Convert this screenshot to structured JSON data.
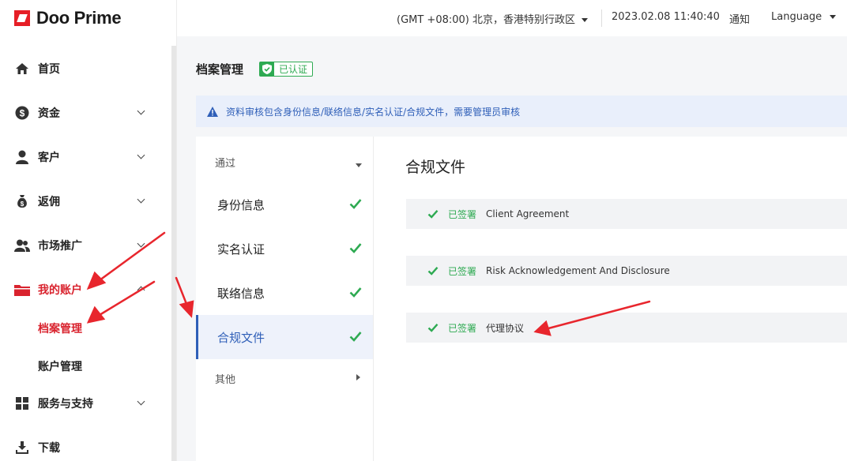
{
  "brand": {
    "name": "Doo Prime"
  },
  "topbar": {
    "timezone": "(GMT +08:00) 北京，香港特别行政区",
    "datetime": "2023.02.08 11:40:40",
    "notifications": "通知",
    "language": "Language"
  },
  "sidebar": {
    "items": [
      {
        "label": "首页",
        "icon": "home-icon"
      },
      {
        "label": "资金",
        "icon": "dollar-icon"
      },
      {
        "label": "客户",
        "icon": "user-icon"
      },
      {
        "label": "返佣",
        "icon": "money-bag-icon"
      },
      {
        "label": "市场推广",
        "icon": "users-icon"
      },
      {
        "label": "我的账户",
        "icon": "folder-icon"
      },
      {
        "label": "服务与支持",
        "icon": "grid-icon"
      },
      {
        "label": "下载",
        "icon": "download-icon"
      }
    ],
    "subitems": [
      {
        "label": "档案管理"
      },
      {
        "label": "账户管理"
      }
    ]
  },
  "page": {
    "title": "档案管理",
    "badge": "已认证",
    "notice": "资料审核包含身份信息/联络信息/实名认证/合规文件，需要管理员审核"
  },
  "tabs": {
    "group_passed": "通过",
    "items": [
      {
        "label": "身份信息"
      },
      {
        "label": "实名认证"
      },
      {
        "label": "联络信息"
      },
      {
        "label": "合规文件"
      }
    ],
    "group_other": "其他"
  },
  "content": {
    "title": "合规文件",
    "documents": [
      {
        "status": "已签署",
        "name": "Client Agreement"
      },
      {
        "status": "已签署",
        "name": "Risk Acknowledgement And Disclosure"
      },
      {
        "status": "已签署",
        "name": "代理协议"
      }
    ]
  },
  "colors": {
    "accent_red": "#d9232e",
    "brand_red": "#e61e26",
    "accent_blue": "#2f5fb8",
    "success_green": "#2eaa52"
  }
}
